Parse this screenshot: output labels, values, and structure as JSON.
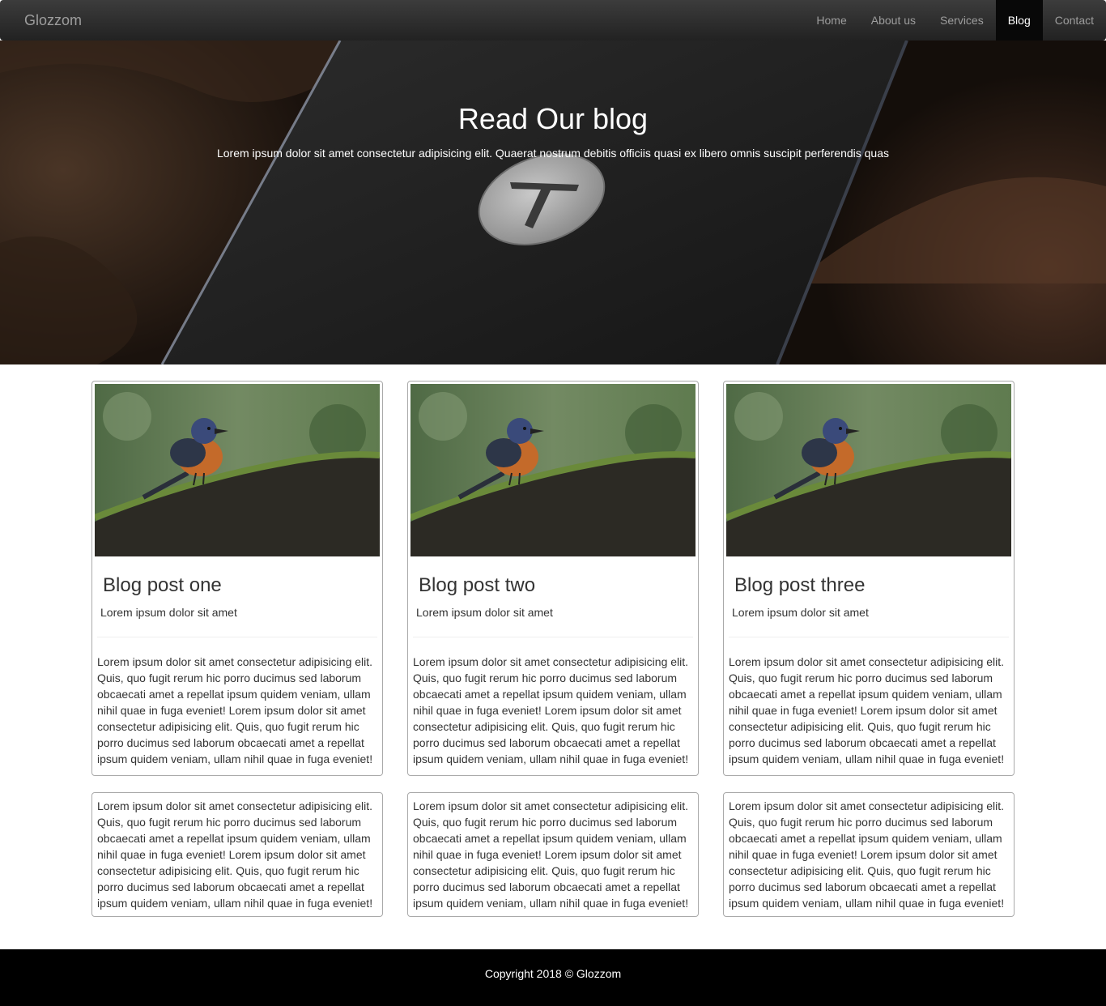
{
  "nav": {
    "brand": "Glozzom",
    "links": [
      "Home",
      "About us",
      "Services",
      "Blog",
      "Contact"
    ],
    "active": "Blog"
  },
  "hero": {
    "title": "Read Our blog",
    "subtitle": "Lorem ipsum dolor sit amet consectetur adipisicing elit. Quaerat nostrum debitis officiis quasi ex libero omnis suscipit perferendis quas"
  },
  "posts": [
    {
      "title": "Blog post one",
      "subtitle": "Lorem ipsum dolor sit amet",
      "body": "Lorem ipsum dolor sit amet consectetur adipisicing elit. Quis, quo fugit rerum hic porro ducimus sed laborum obcaecati amet a repellat ipsum quidem veniam, ullam nihil quae in fuga eveniet! Lorem ipsum dolor sit amet consectetur adipisicing elit. Quis, quo fugit rerum hic porro ducimus sed laborum obcaecati amet a repellat ipsum quidem veniam, ullam nihil quae in fuga eveniet!"
    },
    {
      "title": "Blog post two",
      "subtitle": "Lorem ipsum dolor sit amet",
      "body": "Lorem ipsum dolor sit amet consectetur adipisicing elit. Quis, quo fugit rerum hic porro ducimus sed laborum obcaecati amet a repellat ipsum quidem veniam, ullam nihil quae in fuga eveniet! Lorem ipsum dolor sit amet consectetur adipisicing elit. Quis, quo fugit rerum hic porro ducimus sed laborum obcaecati amet a repellat ipsum quidem veniam, ullam nihil quae in fuga eveniet!"
    },
    {
      "title": "Blog post three",
      "subtitle": "Lorem ipsum dolor sit amet",
      "body": "Lorem ipsum dolor sit amet consectetur adipisicing elit. Quis, quo fugit rerum hic porro ducimus sed laborum obcaecati amet a repellat ipsum quidem veniam, ullam nihil quae in fuga eveniet! Lorem ipsum dolor sit amet consectetur adipisicing elit. Quis, quo fugit rerum hic porro ducimus sed laborum obcaecati amet a repellat ipsum quidem veniam, ullam nihil quae in fuga eveniet!"
    }
  ],
  "text_cards": [
    "Lorem ipsum dolor sit amet consectetur adipisicing elit. Quis, quo fugit rerum hic porro ducimus sed laborum obcaecati amet a repellat ipsum quidem veniam, ullam nihil quae in fuga eveniet! Lorem ipsum dolor sit amet consectetur adipisicing elit. Quis, quo fugit rerum hic porro ducimus sed laborum obcaecati amet a repellat ipsum quidem veniam, ullam nihil quae in fuga eveniet!",
    "Lorem ipsum dolor sit amet consectetur adipisicing elit. Quis, quo fugit rerum hic porro ducimus sed laborum obcaecati amet a repellat ipsum quidem veniam, ullam nihil quae in fuga eveniet! Lorem ipsum dolor sit amet consectetur adipisicing elit. Quis, quo fugit rerum hic porro ducimus sed laborum obcaecati amet a repellat ipsum quidem veniam, ullam nihil quae in fuga eveniet!",
    "Lorem ipsum dolor sit amet consectetur adipisicing elit. Quis, quo fugit rerum hic porro ducimus sed laborum obcaecati amet a repellat ipsum quidem veniam, ullam nihil quae in fuga eveniet! Lorem ipsum dolor sit amet consectetur adipisicing elit. Quis, quo fugit rerum hic porro ducimus sed laborum obcaecati amet a repellat ipsum quidem veniam, ullam nihil quae in fuga eveniet!"
  ],
  "footer": {
    "copyright": "Copyright 2018 © Glozzom"
  },
  "colors": {
    "navbar": "#222222",
    "nav_active": "#080808",
    "footer": "#000000",
    "card_border": "#aaaaaa"
  }
}
